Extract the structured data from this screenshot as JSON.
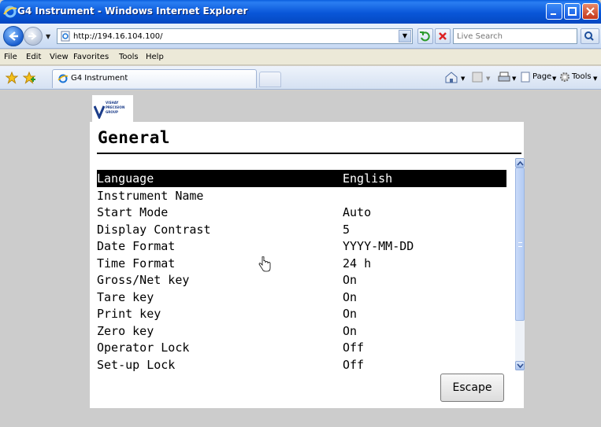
{
  "window": {
    "title": "G4 Instrument - Windows Internet Explorer"
  },
  "address_bar": {
    "url": "http://194.16.104.100/",
    "search_placeholder": "Live Search"
  },
  "menu": {
    "items": [
      "File",
      "Edit",
      "View",
      "Favorites",
      "Tools",
      "Help"
    ]
  },
  "tabs": [
    {
      "label": "G4 Instrument",
      "active": true
    }
  ],
  "toolbar": {
    "page_label": "Page",
    "tools_label": "Tools"
  },
  "page": {
    "heading": "General",
    "settings": [
      {
        "label": "Language",
        "value": "English",
        "selected": true
      },
      {
        "label": "Instrument Name",
        "value": ""
      },
      {
        "label": "Start Mode",
        "value": "Auto"
      },
      {
        "label": "Display Contrast",
        "value": "5"
      },
      {
        "label": "Date Format",
        "value": "YYYY-MM-DD"
      },
      {
        "label": "Time Format",
        "value": "24 h"
      },
      {
        "label": "Gross/Net key",
        "value": "On"
      },
      {
        "label": "Tare key",
        "value": "On"
      },
      {
        "label": "Print key",
        "value": "On"
      },
      {
        "label": "Zero key",
        "value": "On"
      },
      {
        "label": "Operator Lock",
        "value": "Off"
      },
      {
        "label": "Set-up Lock",
        "value": "Off"
      }
    ],
    "escape_label": "Escape"
  },
  "logo": {
    "lines": [
      "VISHAY",
      "PRECISION",
      "GROUP"
    ]
  },
  "colors": {
    "titlebar": "#0956d8",
    "selected_row": "#000000",
    "content_background": "#cccccc"
  }
}
